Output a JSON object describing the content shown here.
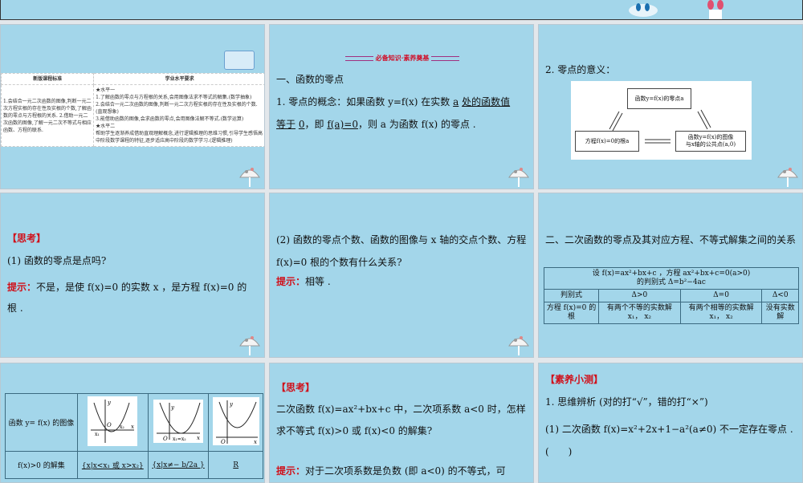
{
  "slides": [
    {
      "standards": {
        "header_left": "新版课程标准",
        "header_right": "学业水平要求",
        "left": "1.会结合一元二次函数的图像,判断一元二次方程实根的存在性及实根的个数,了解函数的零点与方程根的关系. 2.借助一元二次函数的图像,了解一元二次不等式与相应函数、方程的联系.",
        "right_level1": "★水平一",
        "right_items": [
          "1.了解函数的零点与方程根的关系,会用图像法求不等式的解集.(数学抽象)",
          "2.会结合一元二次函数的图像,判断一元二次方程实根的存在性及实根的个数.(直观想象)",
          "3.能借助函数的图像,会求函数的零点,会用图像法解不等式.(数学运算)"
        ],
        "right_level2": "★水平二",
        "right_level2_text": "帮助学生逐渐养成借助直观理解概念,进行逻辑推理的思维习惯,引导学生感悟高中阶段数学课程的特征,逐步适应高中阶段的数学学习.(逻辑推理)"
      }
    },
    {
      "banner": "必备知识·素养奠基",
      "heading": "一、函数的零点",
      "line1_a": "1. 零点的概念：如果函数 y=f(x) 在实数 ",
      "line1_b": "a",
      "line1_c": " ",
      "line1_d": "处的函数值",
      "line2_a": "等于",
      "line2_b": "0",
      "line2_c": "，即 ",
      "line2_d": "f(a)=0",
      "line2_e": "，则 a 为函数 f(x) 的零点 ."
    },
    {
      "heading": "2. 零点的意义：",
      "box_top": "函数y=f(x)的零点a",
      "box_left": "方程f(x)=0的根a",
      "box_right_1": "函数y=f(x)的图像",
      "box_right_2": "与x轴的公共点(a,0)"
    },
    {
      "title": "【思考】",
      "question": "(1) 函数的零点是点吗?",
      "hint_label": "提示：",
      "hint": "不是，是使 f(x)=0 的实数 x ，是方程 f(x)=0 的根 ."
    },
    {
      "question": "(2) 函数的零点个数、函数的图像与 x 轴的交点个数、方程 f(x)=0 根的个数有什么关系?",
      "hint_label": "提示：",
      "hint": "相等 ."
    },
    {
      "heading": "二、二次函数的零点及其对应方程、不等式解集之间的关系",
      "table": {
        "caption_1": "设 f(x)=ax²+bx+c ，方程 ax²+bx+c=0(a>0)",
        "caption_2": "的判别式 Δ=b²−4ac",
        "headers": [
          "判别式",
          "Δ>0",
          "Δ=0",
          "Δ<0"
        ],
        "row": [
          "方程 f(x)=0 的根",
          "有两个不等的实数解 x₁， x₂",
          "有两个相等的实数解 x₁， x₂",
          "没有实数解"
        ]
      }
    },
    {
      "table": {
        "row1_label": "函数 y= f(x) 的图像",
        "row2_label": "f(x)>0 的解集",
        "sol1": "{x|x<x₁ 或 x>x₂}",
        "sol2": "{x|x≠− b/2a }",
        "sol3": "R",
        "graph_labels": {
          "y": "y",
          "o": "O",
          "x": "x",
          "x1": "x₁",
          "x2": "x₂",
          "x1x2": "x₁=x₂"
        }
      }
    },
    {
      "title": "【思考】",
      "question": "二次函数 f(x)=ax²+bx+c 中，二次项系数 a<0 时，怎样求不等式 f(x)>0 或 f(x)<0 的解集?",
      "hint_label": "提示：",
      "hint": "对于二次项系数是负数 (即 a<0) 的不等式，可"
    },
    {
      "title": "【素养小测】",
      "q1": "1. 思维辨析 (对的打“√”，错的打“×”)",
      "q1_1": "(1) 二次函数 f(x)=x²+2x+1−a²(a≠0) 不一定存在零点 . (　　)"
    }
  ]
}
